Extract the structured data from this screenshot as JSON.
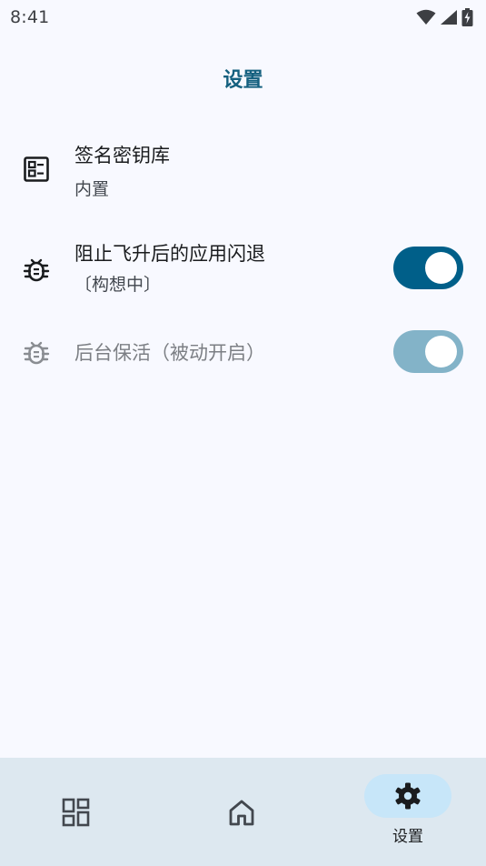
{
  "status_bar": {
    "time": "8:41"
  },
  "page": {
    "title": "设置"
  },
  "settings": [
    {
      "title": "签名密钥库",
      "subtitle": "内置",
      "icon": "keystore-icon"
    },
    {
      "title": "阻止飞升后的应用闪退",
      "subtitle": "〔构想中〕",
      "icon": "bug-icon",
      "toggle_on": true
    },
    {
      "title": "后台保活（被动开启）",
      "icon": "bug-icon",
      "toggle_on": true,
      "disabled": true
    }
  ],
  "bottom_nav": {
    "items": [
      {
        "icon": "dashboard-icon",
        "label": ""
      },
      {
        "icon": "home-icon",
        "label": ""
      },
      {
        "icon": "settings-gear-icon",
        "label": "设置",
        "selected": true
      }
    ]
  },
  "colors": {
    "accent": "#005f89",
    "title": "#14607f",
    "background": "#f8f9ff",
    "nav_background": "#dde8f0",
    "nav_selected_pill": "#c7e6f9"
  }
}
